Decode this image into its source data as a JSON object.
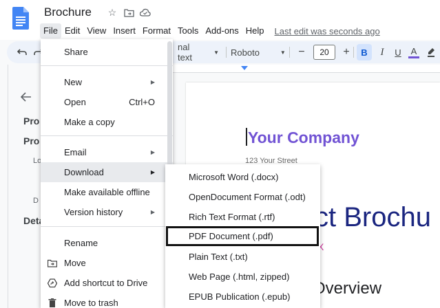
{
  "doc": {
    "title": "Brochure",
    "last_edit": "Last edit was seconds ago"
  },
  "menubar": [
    {
      "label": "File"
    },
    {
      "label": "Edit"
    },
    {
      "label": "View"
    },
    {
      "label": "Insert"
    },
    {
      "label": "Format"
    },
    {
      "label": "Tools"
    },
    {
      "label": "Add-ons"
    },
    {
      "label": "Help"
    }
  ],
  "toolbar": {
    "style": "nal text",
    "font": "Roboto",
    "font_size": "20",
    "minus": "−",
    "plus": "+",
    "bold": "B",
    "italic": "I",
    "underline": "U",
    "textcolor": "A",
    "accent_color": "#7153d4"
  },
  "outline": {
    "pro1": "Pro",
    "pro2": "Pro",
    "lo": "Lo",
    "d": "D",
    "deta": "Deta"
  },
  "page": {
    "company": "Your Company",
    "street": "123 Your Street",
    "brochure": "ct Brochu",
    "x": "X",
    "overview": "Overview"
  },
  "file_menu": {
    "share": "Share",
    "new": "New",
    "open": "Open",
    "open_shortcut": "Ctrl+O",
    "make_copy": "Make a copy",
    "email": "Email",
    "download": "Download",
    "offline": "Make available offline",
    "version_history": "Version history",
    "rename": "Rename",
    "move": "Move",
    "shortcut": "Add shortcut to Drive",
    "trash": "Move to trash"
  },
  "download_menu": [
    {
      "label": "Microsoft Word (.docx)"
    },
    {
      "label": "OpenDocument Format (.odt)"
    },
    {
      "label": "Rich Text Format (.rtf)"
    },
    {
      "label": "PDF Document (.pdf)"
    },
    {
      "label": "Plain Text (.txt)"
    },
    {
      "label": "Web Page (.html, zipped)"
    },
    {
      "label": "EPUB Publication (.epub)"
    }
  ]
}
